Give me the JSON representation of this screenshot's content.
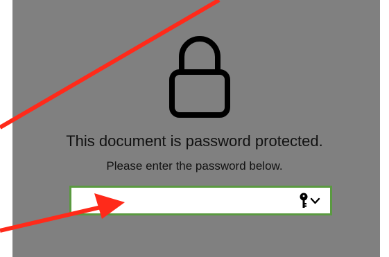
{
  "dialog": {
    "title": "This document is password protected.",
    "subtitle": "Please enter the password below.",
    "password_value": "",
    "password_placeholder": ""
  },
  "icons": {
    "lock": "lock-icon",
    "key": "key-icon",
    "chevron": "chevron-down-icon"
  },
  "colors": {
    "overlay_background": "#808080",
    "input_border": "#5a9a40",
    "annotation_arrow": "#ff2a1a"
  }
}
